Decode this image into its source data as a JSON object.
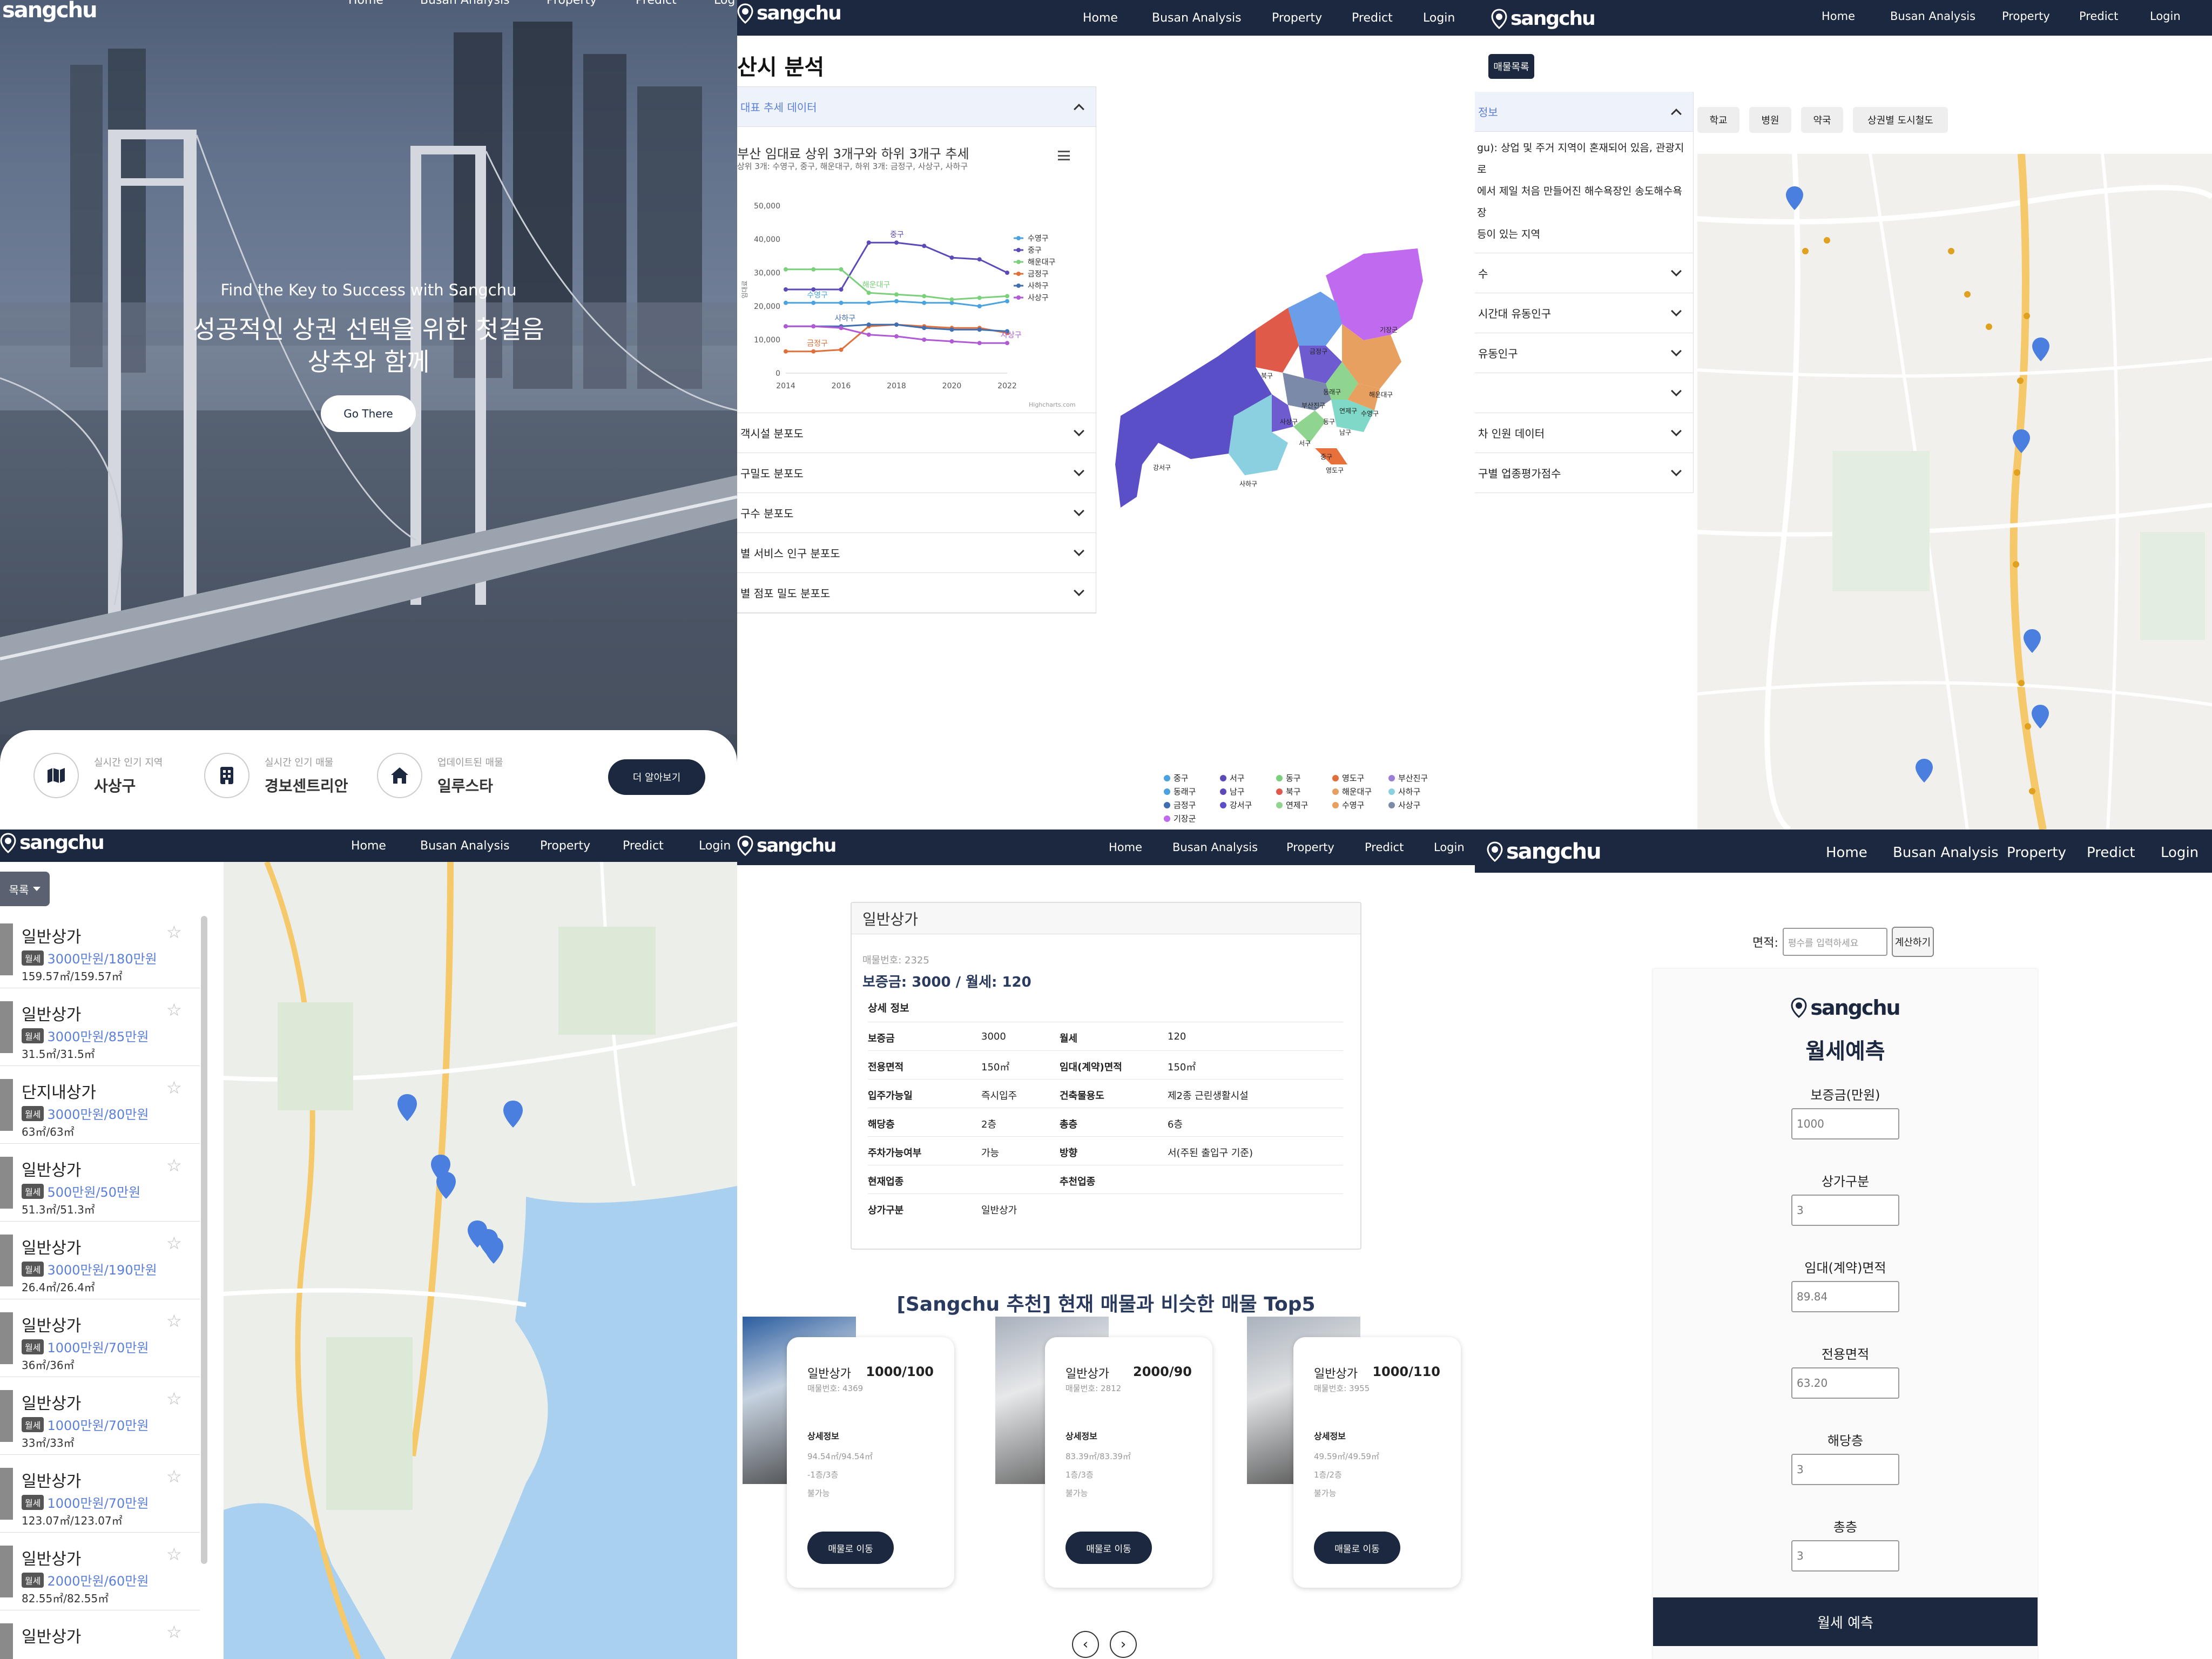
{
  "brand": "sangchu",
  "nav": {
    "home": "Home",
    "busan": "Busan Analysis",
    "property": "Property",
    "predict": "Predict",
    "login": "Login",
    "login_cut": "Log"
  },
  "hero": {
    "tagline": "Find the Key to Success with Sangchu",
    "headline1": "성공적인 상권 선택을 위한 첫걸음",
    "headline2": "상추와 함께",
    "cta": "Go There",
    "cards": [
      {
        "icon": "map-icon",
        "label": "실시간 인기 지역",
        "value": "사상구"
      },
      {
        "icon": "building-icon",
        "label": "실시간 인기 매물",
        "value": "경보센트리안"
      },
      {
        "icon": "home-icon",
        "label": "업데이트된 매물",
        "value": "일루스타"
      }
    ],
    "more": "더 알아보기"
  },
  "analysis": {
    "title": "산시 분석",
    "open_section": "대표 추세 데이터",
    "chart_title": "부산 임대료 상위 3개구와 하위 3개구 추세",
    "chart_subtitle": "상위 3개: 수영구, 중구, 해운대구, 하위 3개: 금정구, 사상구, 사하구",
    "credit": "Highcharts.com",
    "menu_icon": "hamburger-menu-icon",
    "sections": [
      "객시설 분포도",
      "구밀도 분포도",
      "구수 분포도",
      "별 서비스 인구 분포도",
      "별 점포 밀도 분포도"
    ],
    "map_labels": [
      "기장군",
      "금정구",
      "해운대구",
      "북구",
      "동래구",
      "연제구",
      "수영구",
      "사상구",
      "부산진구",
      "남구",
      "동구",
      "서구",
      "중구",
      "영도구",
      "사하구",
      "강서구"
    ],
    "map_legend": [
      "중구",
      "서구",
      "동구",
      "영도구",
      "부산진구",
      "동래구",
      "남구",
      "북구",
      "해운대구",
      "사하구",
      "금정구",
      "강서구",
      "연제구",
      "수영구",
      "사상구",
      "기장군"
    ]
  },
  "chart_data": {
    "type": "line",
    "title": "부산 임대료 상위 3개구와 하위 3개구 추세",
    "subtitle": "상위 3개: 수영구, 중구, 해운대구, 하위 3개: 금정구, 사상구, 사하구",
    "x": [
      2014,
      2015,
      2016,
      2017,
      2018,
      2019,
      2020,
      2021,
      2022
    ],
    "x_ticks": [
      2014,
      2016,
      2018,
      2020,
      2022
    ],
    "ylim": [
      0,
      50000
    ],
    "y_ticks": [
      0,
      10000,
      20000,
      30000,
      40000,
      50000
    ],
    "ylabel": "임대료",
    "grid": false,
    "legend": "right",
    "series": [
      {
        "name": "수영구",
        "color": "#4aa3df",
        "values": [
          21000,
          21000,
          21000,
          21000,
          21500,
          21000,
          21000,
          20000,
          21500
        ],
        "label": "수영구",
        "label_at": 1
      },
      {
        "name": "중구",
        "color": "#5d4ab8",
        "values": [
          25000,
          25000,
          25000,
          39000,
          39000,
          38000,
          34500,
          34000,
          30000
        ],
        "label": "중구",
        "label_at": 4
      },
      {
        "name": "해운대구",
        "color": "#7bd07b",
        "values": [
          31000,
          31000,
          31000,
          24000,
          23500,
          23000,
          22000,
          22500,
          23000
        ],
        "label": "해운대구",
        "label_at": 3
      },
      {
        "name": "금정구",
        "color": "#e0703a",
        "values": [
          6500,
          6500,
          7000,
          14000,
          14500,
          14000,
          13500,
          13500,
          12000
        ],
        "label": "금정구",
        "label_at": 1
      },
      {
        "name": "사하구",
        "color": "#3f6fb0",
        "values": [
          14000,
          14000,
          14000,
          14500,
          14500,
          13500,
          13000,
          13000,
          12500
        ],
        "label": "사하구",
        "label_at": 2
      },
      {
        "name": "사상구",
        "color": "#b05ad6",
        "values": [
          14000,
          14000,
          13500,
          11500,
          11000,
          10000,
          9500,
          9000,
          9000
        ],
        "label": "사상구",
        "label_at": 8
      }
    ]
  },
  "map_page": {
    "listing_btn": "매물목록",
    "section_open": "정보",
    "desc1": "gu): 상업 및 주거 지역이 혼재되어 있음, 관광지로",
    "desc2": "에서 제일 처음 만들어진 해수욕장인 송도해수욕장",
    "desc3": " 등이 있는 지역",
    "sections": [
      "수",
      "시간대 유동인구",
      "유동인구",
      "",
      "차 인원 데이터",
      "구별 업종평가점수"
    ],
    "tabs": [
      "학교",
      "병원",
      "약국",
      "상권별 도시철도"
    ]
  },
  "listings": {
    "toggle": "목록",
    "items": [
      {
        "title": "일반상가",
        "price": "3000만원/180만원",
        "area": "159.57㎡/159.57㎡"
      },
      {
        "title": "일반상가",
        "price": "3000만원/85만원",
        "area": "31.5㎡/31.5㎡"
      },
      {
        "title": "단지내상가",
        "price": "3000만원/80만원",
        "area": "63㎡/63㎡"
      },
      {
        "title": "일반상가",
        "price": "500만원/50만원",
        "area": "51.3㎡/51.3㎡"
      },
      {
        "title": "일반상가",
        "price": "3000만원/190만원",
        "area": "26.4㎡/26.4㎡"
      },
      {
        "title": "일반상가",
        "price": "1000만원/70만원",
        "area": "36㎡/36㎡"
      },
      {
        "title": "일반상가",
        "price": "1000만원/70만원",
        "area": "33㎡/33㎡"
      },
      {
        "title": "일반상가",
        "price": "1000만원/70만원",
        "area": "123.07㎡/123.07㎡"
      },
      {
        "title": "일반상가",
        "price": "2000만원/60만원",
        "area": "82.55㎡/82.55㎡"
      },
      {
        "title": "일반상가",
        "price": "",
        "area": ""
      }
    ],
    "badge": "월세"
  },
  "detail": {
    "title": "일반상가",
    "number": "매물번호: 2325",
    "price": "보증금: 3000 / 월세: 120",
    "section": "상세 정보",
    "rows": [
      [
        "보증금",
        "3000",
        "월세",
        "120"
      ],
      [
        "전용면적",
        "150㎡",
        "임대(계약)면적",
        "150㎡"
      ],
      [
        "입주가능일",
        "즉시입주",
        "건축물용도",
        "제2종 근린생활시설"
      ],
      [
        "해당층",
        "2층",
        "총층",
        "6층"
      ],
      [
        "주차가능여부",
        "가능",
        "방향",
        "서(주된 출입구 기준)"
      ],
      [
        "현재업종",
        "",
        "추천업종",
        ""
      ],
      [
        "상가구분",
        "일반상가",
        "",
        ""
      ]
    ],
    "rec_title": "[Sangchu 추천] 현재 매물과 비슷한 매물 Top5",
    "cards": [
      {
        "type": "일반상가",
        "price": "1000/100",
        "number": "매물번호: 4369",
        "section": "상세정보",
        "area": "94.54㎡/94.54㎡",
        "floor": "-1층/3층",
        "parking": "불가능",
        "btn": "매물로 이동"
      },
      {
        "type": "일반상가",
        "price": "2000/90",
        "number": "매물번호: 2812",
        "section": "상세정보",
        "area": "83.39㎡/83.39㎡",
        "floor": "1층/3층",
        "parking": "불가능",
        "btn": "매물로 이동"
      },
      {
        "type": "일반상가",
        "price": "1000/110",
        "number": "매물번호: 3955",
        "section": "상세정보",
        "area": "49.59㎡/49.59㎡",
        "floor": "1층/2층",
        "parking": "불가능",
        "btn": "매물로 이동"
      }
    ]
  },
  "predict": {
    "area_label": "면적:",
    "area_placeholder": "평수를 입력하세요",
    "calc": "계산하기",
    "title": "월세예측",
    "fields": [
      {
        "label": "보증금(만원)",
        "value": "1000"
      },
      {
        "label": "상가구분",
        "value": "3"
      },
      {
        "label": "임대(계약)면적",
        "value": "89.84"
      },
      {
        "label": "전용면적",
        "value": "63.20"
      },
      {
        "label": "해당층",
        "value": "3"
      },
      {
        "label": "총층",
        "value": "3"
      }
    ],
    "submit": "월세 예측"
  }
}
